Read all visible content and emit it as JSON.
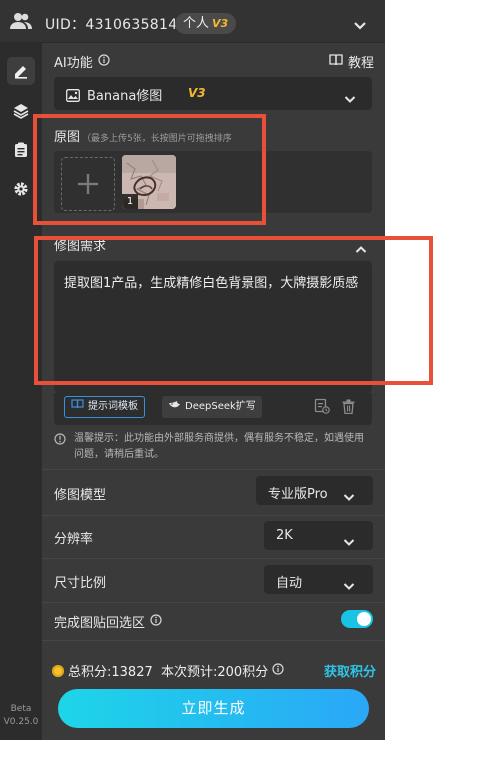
{
  "header": {
    "uid_text": "UID：4310635814",
    "plan_label": "个人",
    "plan_version": "V3"
  },
  "sidebar": {
    "icons": [
      "edit-icon",
      "layers-icon",
      "clipboard-icon",
      "gear-icon"
    ],
    "beta_label": "Beta",
    "version": "V0.25.0"
  },
  "ai_function": {
    "label": "AI功能",
    "tutorial_label": "教程",
    "selected": "Banana修图",
    "selected_version": "V3"
  },
  "original_image": {
    "label": "原图",
    "hint": "（最多上传5张，长按图片可拖拽排序",
    "thumbnails": [
      {
        "index": "1"
      }
    ]
  },
  "edit_request": {
    "label": "修图需求",
    "text": "提取图1产品，生成精修白色背景图，大牌摄影质感",
    "template_button": "提示词模板",
    "deepseek_button": "DeepSeek扩写"
  },
  "notice": "温馨提示：此功能由外部服务商提供，偶有服务不稳定，如遇使用问题，请稍后重试。",
  "settings": {
    "model_label": "修图模型",
    "model_value": "专业版Pro",
    "resolution_label": "分辨率",
    "resolution_value": "2K",
    "ratio_label": "尺寸比例",
    "ratio_value": "自动",
    "paste_back_label": "完成图贴回选区",
    "paste_back_on": true
  },
  "footer": {
    "points_text": "总积分:13827  本次预计:200积分",
    "get_points": "获取积分",
    "generate_button": "立即生成"
  },
  "colors": {
    "accent": "#19c3e6",
    "annotation_red": "#e8503a",
    "version_gold": "#f5b731"
  }
}
